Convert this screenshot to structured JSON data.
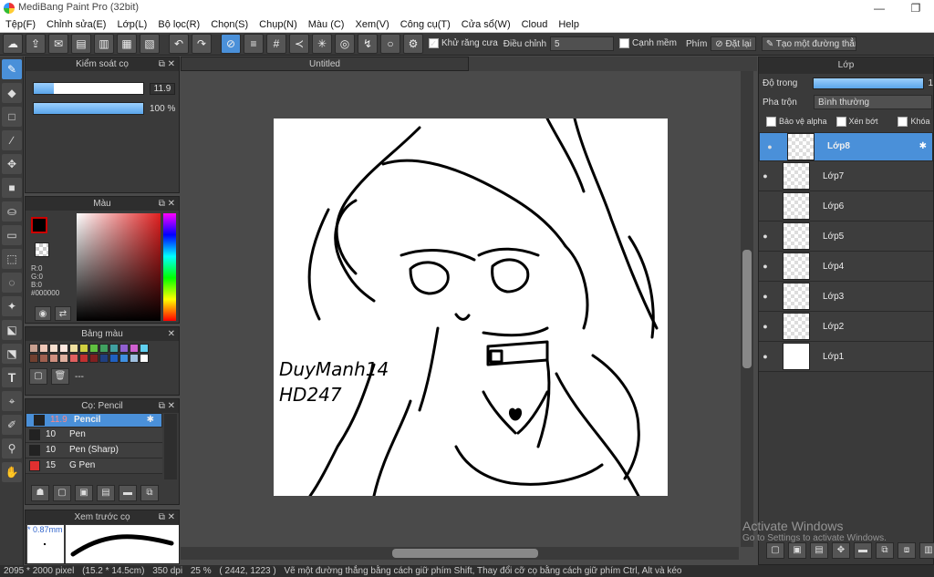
{
  "app": {
    "title": "MediBang Paint Pro (32bit)"
  },
  "menu": [
    "Tệp(F)",
    "Chỉnh sửa(E)",
    "Lớp(L)",
    "Bộ lọc(R)",
    "Chọn(S)",
    "Chụp(N)",
    "Màu (C)",
    "Xem(V)",
    "Công cụ(T)",
    "Cửa sổ(W)",
    "Cloud",
    "Help"
  ],
  "toolbar": {
    "antialias_label": "Khử răng cưa",
    "adjust_label": "Điều chỉnh",
    "adjust_value": "5",
    "edge_label": "Cạnh mềm",
    "key_label": "Phím",
    "reset_label": "Đặt lại",
    "line_label": "Tạo một đường thẳng"
  },
  "brush_control": {
    "title": "Kiểm soát cọ",
    "size_value": "11.9",
    "size_fraction": 0.18,
    "opacity_value": "100 %",
    "opacity_fraction": 1.0
  },
  "color_panel": {
    "title": "Màu",
    "r": "R:0",
    "g": "G:0",
    "b": "B:0",
    "hex": "#000000"
  },
  "palette": {
    "title": "Bảng màu",
    "extra": "---",
    "colors": [
      "#c8a090",
      "#f0c8b8",
      "#f8e0d0",
      "#ffe8e0",
      "#f0e0a0",
      "#d0d040",
      "#60c040",
      "#40a060",
      "#40a0a0",
      "#9060d0",
      "#d060d0",
      "#60d0f0",
      "#704030",
      "#a06050",
      "#d09080",
      "#e0b0a0",
      "#e06060",
      "#c03030",
      "#802020",
      "#204080",
      "#2060c0",
      "#4090e0",
      "#a0c0e0",
      "#ffffff"
    ]
  },
  "brush_panel": {
    "title": "Cọ: Pencil",
    "items": [
      {
        "size": "11.9",
        "name": "Pencil",
        "color": "#222222",
        "selected": true
      },
      {
        "size": "10",
        "name": "Pen",
        "color": "#222222",
        "selected": false
      },
      {
        "size": "10",
        "name": "Pen (Sharp)",
        "color": "#222222",
        "selected": false
      },
      {
        "size": "15",
        "name": "G Pen",
        "color": "#e03030",
        "selected": false
      }
    ]
  },
  "preview": {
    "title": "Xem trước cọ",
    "size": "* 0.87mm"
  },
  "canvas": {
    "tab_title": "Untitled",
    "signature_line1": "DuyManh14",
    "signature_line2": "HD247"
  },
  "layer_panel": {
    "title": "Lớp",
    "opacity_label": "Độ trong",
    "opacity_value": "1",
    "opacity_fraction": 1.0,
    "blend_label": "Pha trộn",
    "blend_value": "Bình thường",
    "protect_alpha": "Bảo vệ alpha",
    "clipping": "Xén bớt",
    "lock": "Khóa",
    "layers": [
      {
        "name": "Lớp8",
        "visible": true,
        "selected": true
      },
      {
        "name": "Lớp7",
        "visible": true,
        "selected": false
      },
      {
        "name": "Lớp6",
        "visible": false,
        "selected": false
      },
      {
        "name": "Lớp5",
        "visible": true,
        "selected": false
      },
      {
        "name": "Lớp4",
        "visible": true,
        "selected": false
      },
      {
        "name": "Lớp3",
        "visible": true,
        "selected": false
      },
      {
        "name": "Lớp2",
        "visible": true,
        "selected": false
      },
      {
        "name": "Lớp1",
        "visible": true,
        "selected": false
      }
    ]
  },
  "watermark": {
    "line1": "Activate Windows",
    "line2": "Go to Settings to activate Windows."
  },
  "status": {
    "size": "2095 * 2000 pixel",
    "mm": "(15.2 * 14.5cm)",
    "dpi": "350 dpi",
    "zoom": "25 %",
    "coords": "( 2442, 1223 )",
    "hint": "Vẽ một đường thẳng bằng cách giữ phím Shift, Thay đổi cỡ cọ bằng cách giữ phím Ctrl, Alt và kéo"
  }
}
